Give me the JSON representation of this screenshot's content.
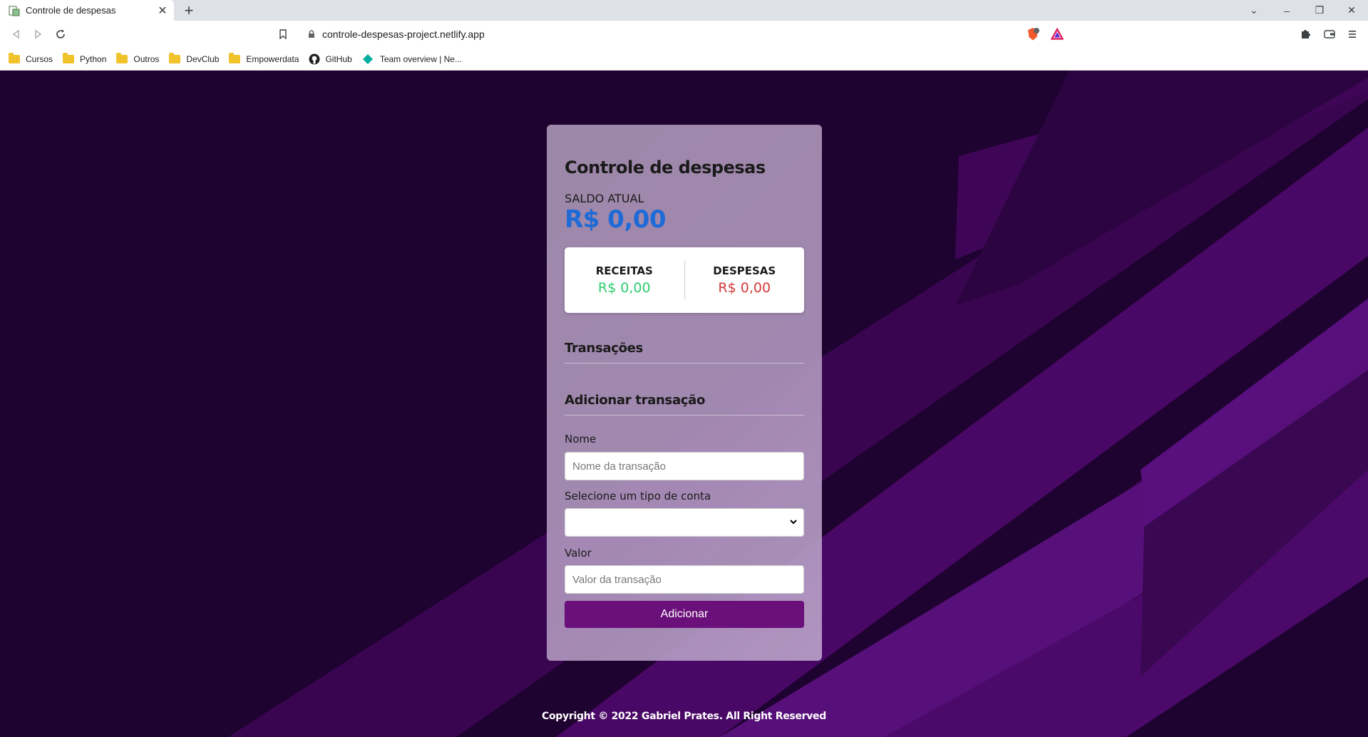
{
  "browser": {
    "tab_title": "Controle de despesas",
    "url": "controle-despesas-project.netlify.app",
    "bookmarks": [
      {
        "label": "Cursos",
        "icon": "folder-icon"
      },
      {
        "label": "Python",
        "icon": "folder-icon"
      },
      {
        "label": "Outros",
        "icon": "folder-icon"
      },
      {
        "label": "DevClub",
        "icon": "folder-icon"
      },
      {
        "label": "Empowerdata",
        "icon": "folder-icon"
      },
      {
        "label": "GitHub",
        "icon": "github-icon"
      },
      {
        "label": "Team overview | Ne...",
        "icon": "diamond-icon"
      }
    ]
  },
  "app": {
    "title": "Controle de despesas",
    "saldo_label": "SALDO ATUAL",
    "saldo_value": "R$ 0,00",
    "receitas_label": "RECEITAS",
    "receitas_value": "R$ 0,00",
    "despesas_label": "DESPESAS",
    "despesas_value": "R$ 0,00",
    "transacoes_title": "Transações",
    "add_title": "Adicionar transação",
    "nome_label": "Nome",
    "nome_placeholder": "Nome da transação",
    "tipo_label": "Selecione um tipo de conta",
    "tipo_value": "",
    "valor_label": "Valor",
    "valor_placeholder": "Valor da transação",
    "add_button": "Adicionar"
  },
  "footer": {
    "text": "Copyright © 2022 Gabriel Prates. All Right Reserved"
  },
  "colors": {
    "background": "#1e0230",
    "saldo": "#1e6ad6",
    "receitas": "#2ecc71",
    "despesas": "#d63a3a",
    "button": "#6b0f7a"
  }
}
